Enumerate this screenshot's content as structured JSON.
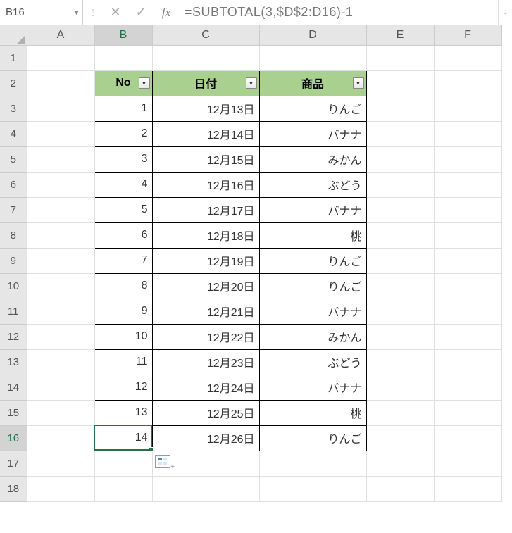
{
  "name_box": "B16",
  "formula": "=SUBTOTAL(3,$D$2:D16)-1",
  "columns": [
    "A",
    "B",
    "C",
    "D",
    "E",
    "F"
  ],
  "active_col": "B",
  "active_row": 16,
  "row_count": 18,
  "headers": {
    "no": "No",
    "date": "日付",
    "product": "商品"
  },
  "rows": [
    {
      "no": "1",
      "date": "12月13日",
      "product": "りんご"
    },
    {
      "no": "2",
      "date": "12月14日",
      "product": "バナナ"
    },
    {
      "no": "3",
      "date": "12月15日",
      "product": "みかん"
    },
    {
      "no": "4",
      "date": "12月16日",
      "product": "ぶどう"
    },
    {
      "no": "5",
      "date": "12月17日",
      "product": "バナナ"
    },
    {
      "no": "6",
      "date": "12月18日",
      "product": "桃"
    },
    {
      "no": "7",
      "date": "12月19日",
      "product": "りんご"
    },
    {
      "no": "8",
      "date": "12月20日",
      "product": "りんご"
    },
    {
      "no": "9",
      "date": "12月21日",
      "product": "バナナ"
    },
    {
      "no": "10",
      "date": "12月22日",
      "product": "みかん"
    },
    {
      "no": "11",
      "date": "12月23日",
      "product": "ぶどう"
    },
    {
      "no": "12",
      "date": "12月24日",
      "product": "バナナ"
    },
    {
      "no": "13",
      "date": "12月25日",
      "product": "桃"
    },
    {
      "no": "14",
      "date": "12月26日",
      "product": "りんご"
    }
  ]
}
